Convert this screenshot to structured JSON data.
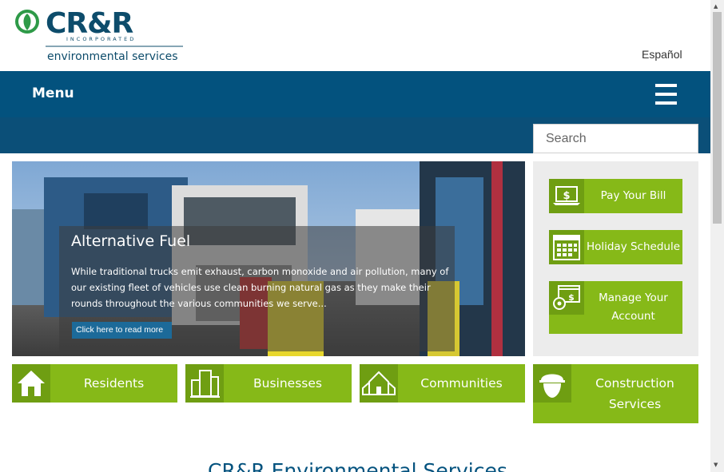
{
  "header": {
    "logo_text": "CR&R",
    "logo_incorporated": "INCORPORATED",
    "logo_subtitle": "environmental services",
    "language_link": "Español"
  },
  "nav": {
    "menu_label": "Menu",
    "menu_icon": "hamburger-icon"
  },
  "search": {
    "placeholder": "Search"
  },
  "hero": {
    "title": "Alternative Fuel",
    "text": "While traditional trucks emit exhaust, carbon monoxide and air pollution, many of our existing fleet of vehicles use clean burning natural gas as they make their rounds throughout the various communities we serve...",
    "button_label": "Click here to read more"
  },
  "quick_links": [
    {
      "label": "Pay Your Bill",
      "icon": "laptop-dollar-icon"
    },
    {
      "label": "Holiday Schedule",
      "icon": "calendar-icon"
    },
    {
      "label": "Manage Your Account",
      "icon": "account-settings-icon"
    }
  ],
  "categories": [
    {
      "label": "Residents",
      "icon": "house-icon"
    },
    {
      "label": "Businesses",
      "icon": "buildings-icon"
    },
    {
      "label": "Communities",
      "icon": "community-icon"
    },
    {
      "label": "Construction Services",
      "icon": "hardhat-worker-icon"
    }
  ],
  "section_heading": "CR&R Environmental Services",
  "colors": {
    "brand_blue": "#03527e",
    "brand_green": "#86b918",
    "icon_green": "#6f9e12"
  }
}
